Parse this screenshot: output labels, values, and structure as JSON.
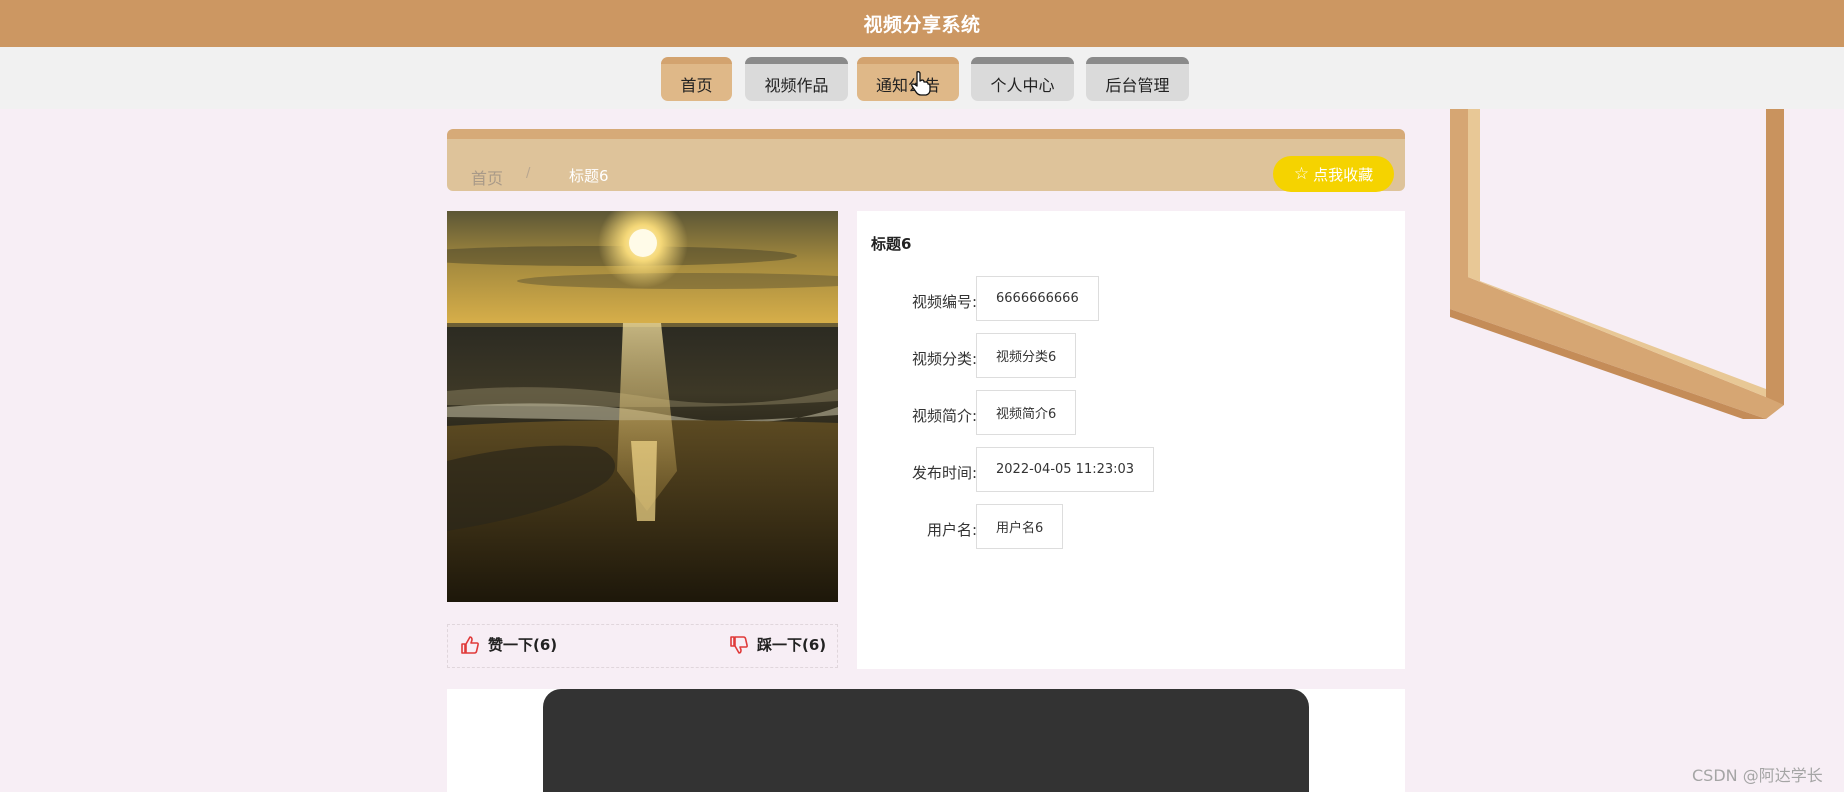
{
  "header": {
    "title": "视频分享系统"
  },
  "nav": {
    "items": [
      {
        "label": "首页",
        "active": true
      },
      {
        "label": "视频作品",
        "active": false
      },
      {
        "label": "通知公告",
        "active": true
      },
      {
        "label": "个人中心",
        "active": false
      },
      {
        "label": "后台管理",
        "active": false
      }
    ]
  },
  "breadcrumb": {
    "home": "首页",
    "separator": "/",
    "current": "标题6"
  },
  "collect_button": {
    "label": "点我收藏",
    "icon": "star-outline-icon"
  },
  "detail": {
    "title": "标题6",
    "fields": [
      {
        "label": "视频编号:",
        "value": "6666666666"
      },
      {
        "label": "视频分类:",
        "value": "视频分类6"
      },
      {
        "label": "视频简介:",
        "value": "视频简介6"
      },
      {
        "label": "发布时间:",
        "value": "2022-04-05 11:23:03"
      },
      {
        "label": "用户名:",
        "value": "用户名6"
      }
    ]
  },
  "votes": {
    "like_label": "赞一下(6)",
    "dislike_label": "踩一下(6)",
    "like_icon": "thumbs-up-icon",
    "dislike_icon": "thumbs-down-icon"
  },
  "colors": {
    "header_bg": "#cc9762",
    "nav_active": "#dfb888",
    "collect_btn": "#f5d300",
    "vote_icon": "#e03a3a"
  },
  "watermark": "CSDN @阿达学长"
}
